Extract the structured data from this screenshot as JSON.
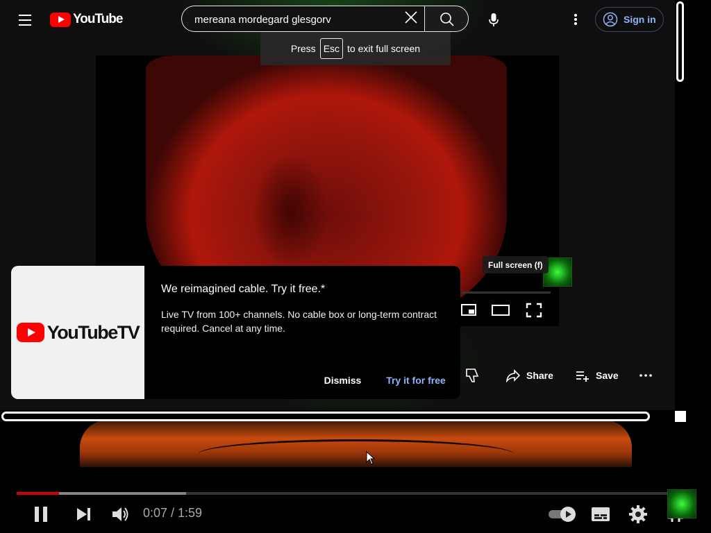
{
  "app": {
    "logo_text": "YouTube"
  },
  "search": {
    "query": "mereana mordegard glesgorv"
  },
  "masthead": {
    "signin_label": "Sign in"
  },
  "fullscreen_toast": {
    "prefix": "Press",
    "key": "Esc",
    "suffix": "to exit full screen"
  },
  "inner_player": {
    "tooltip": "Full screen (f)"
  },
  "actions": {
    "share_label": "Share",
    "save_label": "Save"
  },
  "promo": {
    "brand_text": "YouTubeTV",
    "title": "We reimagined cable. Try it free.*",
    "body": "Live TV from 100+ channels. No cable box or long-term contract required. Cancel at any time.",
    "dismiss_label": "Dismiss",
    "cta_label": "Try it for free"
  },
  "player": {
    "time_display": "0:07 / 1:59",
    "progress_played_fraction": 0.062,
    "progress_buffered_fraction": 0.25
  },
  "colors": {
    "brand_red": "#ff0000",
    "link_blue": "#8fb5ff",
    "progress_red": "#cc0000"
  },
  "icons": [
    "menu-icon",
    "search-icon",
    "clear-icon",
    "mic-icon",
    "more-vert-icon",
    "account-icon",
    "miniplayer-icon",
    "theater-icon",
    "fullscreen-icon",
    "dislike-icon",
    "share-icon",
    "save-icon",
    "more-horiz-icon",
    "pause-icon",
    "next-icon",
    "volume-icon",
    "autoplay-toggle-icon",
    "subtitles-icon",
    "settings-icon",
    "fullscreen-exit-icon"
  ]
}
